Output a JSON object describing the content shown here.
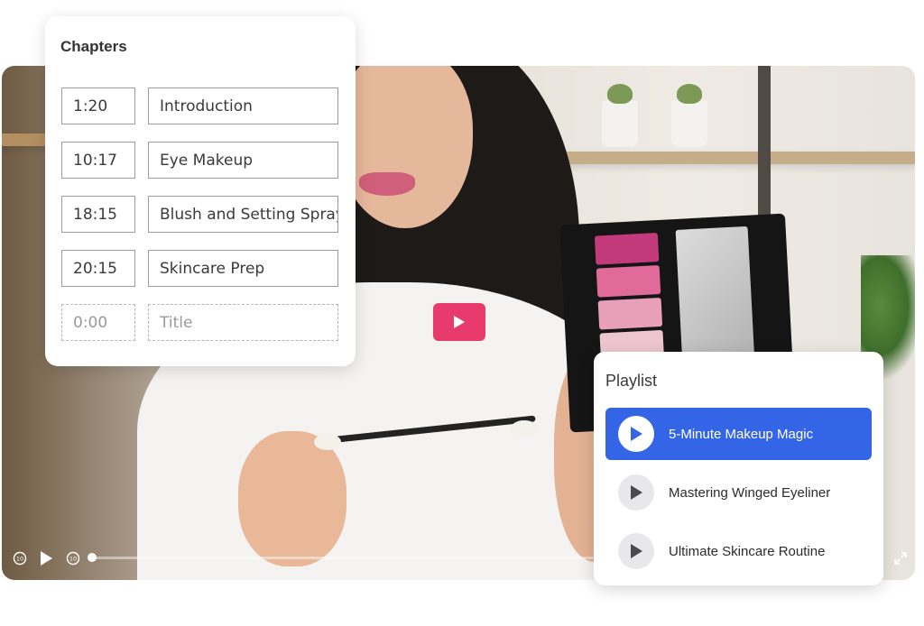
{
  "chapters": {
    "title": "Chapters",
    "items": [
      {
        "time": "1:20",
        "title": "Introduction"
      },
      {
        "time": "10:17",
        "title": "Eye Makeup"
      },
      {
        "time": "18:15",
        "title": "Blush and Setting Spray"
      },
      {
        "time": "20:15",
        "title": "Skincare Prep"
      }
    ],
    "new_entry": {
      "time_placeholder": "0:00",
      "title_placeholder": "Title"
    }
  },
  "playlist": {
    "title": "Playlist",
    "items": [
      {
        "label": "5-Minute Makeup Magic",
        "active": true
      },
      {
        "label": "Mastering Winged Eyeliner",
        "active": false
      },
      {
        "label": "Ultimate Skincare Routine",
        "active": false
      }
    ]
  },
  "player": {
    "progress_fraction": 0.0,
    "accent_color": "#e93a6d",
    "icons": [
      "rewind-10-icon",
      "play-icon",
      "forward-10-icon",
      "fullscreen-icon"
    ]
  },
  "colors": {
    "playlist_active": "#3465e6",
    "play_button": "#e93a6d"
  }
}
